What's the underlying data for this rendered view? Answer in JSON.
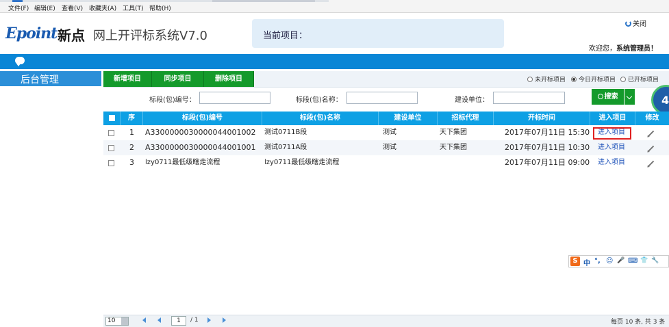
{
  "menu": [
    "文件(F)",
    "编辑(E)",
    "查看(V)",
    "收藏夹(A)",
    "工具(T)",
    "帮助(H)"
  ],
  "header": {
    "logo_en": "Epoint",
    "logo_cn": "新点",
    "system_title": "网上开评标系统V7.0",
    "current_project_label": "当前项目：",
    "close_label": "关闭",
    "welcome_prefix": "欢迎您，",
    "welcome_user": "系统管理员！"
  },
  "sidebar": {
    "title": "后台管理"
  },
  "toolbar": {
    "buttons": [
      "新增项目",
      "同步项目",
      "删除项目"
    ],
    "radios": [
      {
        "label": "未开标项目",
        "checked": false
      },
      {
        "label": "今日开标项目",
        "checked": true
      },
      {
        "label": "已开标项目",
        "checked": false
      }
    ]
  },
  "search": {
    "labels": [
      "标段(包)编号：",
      "标段(包)名称：",
      "建设单位："
    ],
    "values": [
      "",
      "",
      ""
    ],
    "button": "搜索"
  },
  "float_badge": "4",
  "table": {
    "headers": [
      "序",
      "标段(包)编号",
      "标段(包)名称",
      "建设单位",
      "招标代理",
      "开标时间",
      "进入项目",
      "修改"
    ],
    "rows": [
      {
        "no": "1",
        "code": "A3300000030000044001002",
        "name": "测试0711B段",
        "unit": "测试",
        "agent": "天下集团",
        "time": "2017年07月11日 15:30",
        "enter": "进入项目"
      },
      {
        "no": "2",
        "code": "A3300000030000044001001",
        "name": "测试0711A段",
        "unit": "测试",
        "agent": "天下集团",
        "time": "2017年07月11日 10:30",
        "enter": "进入项目"
      },
      {
        "no": "3",
        "code": "lzy0711最低级瞎走流程",
        "name": "lzy0711最低级瞎走流程",
        "unit": "",
        "agent": "",
        "time": "2017年07月11日 09:00",
        "enter": "进入项目"
      }
    ]
  },
  "ime": {
    "logo": "S",
    "glyphs": [
      "中",
      "°,",
      "☺",
      "🎤",
      "⌨",
      "👕",
      "🔧"
    ]
  },
  "pager": {
    "page_size": "10",
    "current": "1",
    "total": "/ 1",
    "summary": "每页 10 条, 共 3 条"
  },
  "colors": {
    "accent_blue": "#0a86d6",
    "header_blue": "#0ea0e4",
    "button_green": "#149a2b",
    "highlight_red": "#e02020"
  }
}
